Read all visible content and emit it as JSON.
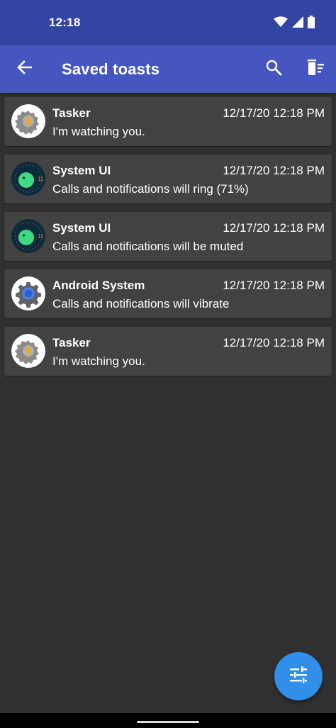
{
  "status_bar": {
    "time": "12:18",
    "icons": [
      "wifi-icon",
      "signal-icon",
      "battery-icon"
    ]
  },
  "app_bar": {
    "title": "Saved toasts",
    "back_icon": "arrow-back-icon",
    "search_icon": "search-icon",
    "delete_icon": "delete-sweep-icon",
    "background": "#4556c1",
    "status_background": "#3345a3"
  },
  "toasts": [
    {
      "app": "Tasker",
      "time": "12/17/20 12:18 PM",
      "message": "I'm watching you.",
      "icon": "tasker-icon"
    },
    {
      "app": "System UI",
      "time": "12/17/20 12:18 PM",
      "message": "Calls and notifications will ring (71%)",
      "icon": "android-11-icon"
    },
    {
      "app": "System UI",
      "time": "12/17/20 12:18 PM",
      "message": "Calls and notifications will be muted",
      "icon": "android-11-icon"
    },
    {
      "app": "Android System",
      "time": "12/17/20 12:18 PM",
      "message": "Calls and notifications will vibrate",
      "icon": "settings-gear-icon"
    },
    {
      "app": "Tasker",
      "time": "12/17/20 12:18 PM",
      "message": "I'm watching you.",
      "icon": "tasker-icon"
    }
  ],
  "fab": {
    "icon": "filter-tune-icon",
    "color": "#2f8fe9"
  }
}
